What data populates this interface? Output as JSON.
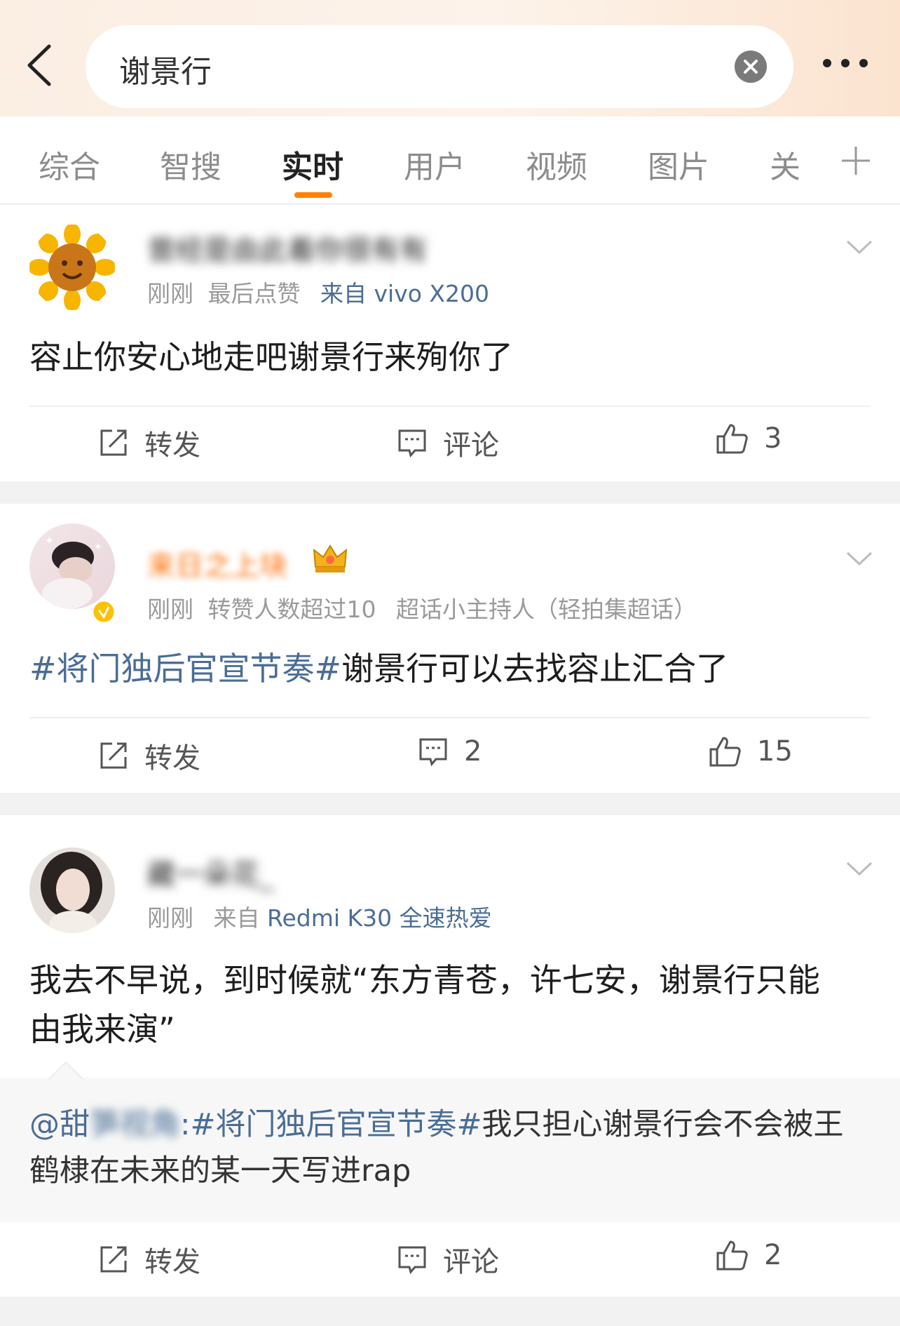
{
  "header": {
    "search_text": "谢景行"
  },
  "tabs": [
    {
      "label": "综合"
    },
    {
      "label": "智搜"
    },
    {
      "label": "实时",
      "active": true
    },
    {
      "label": "用户"
    },
    {
      "label": "视频"
    },
    {
      "label": "图片"
    },
    {
      "label": "关"
    }
  ],
  "colors": {
    "accent": "#ff8200",
    "link": "#4a6d96",
    "verified_badge": "#ffc107"
  },
  "posts": [
    {
      "username": "曾经是由此着你很有有",
      "meta_time": "刚刚",
      "meta_info": "最后点赞",
      "meta_source": "来自 vivo X200",
      "text": "容止你安心地走吧谢景行来殉你了",
      "repost_label": "转发",
      "comment_label": "评论",
      "like_count": "3"
    },
    {
      "username": "来日之上块",
      "meta_time": "刚刚",
      "meta_info": "转赞人数超过10",
      "meta_source": "超话小主持人（轻拍集超话）",
      "topic": "#将门独后官宣节奏#",
      "text": "谢景行可以去找容止汇合了",
      "repost_label": "转发",
      "comment_count": "2",
      "like_count": "15"
    },
    {
      "username": "藏一朵花_",
      "meta_time": "刚刚",
      "meta_source_prefix": "来自",
      "meta_source": "Redmi K30 全速热爱",
      "text_line1": "我去不早说，到时候就“东方青苍，许七安，谢景行只能",
      "text_line2": "由我来演”",
      "quote_mention": "@甜",
      "quote_mention_blurred": "笋视角",
      "quote_topic": ":#将门独后官宣节奏#",
      "quote_text_line1": "我只担心谢景行会不会被王",
      "quote_text_line2": "鹤棣在未来的某一天写进rap",
      "repost_label": "转发",
      "comment_label": "评论",
      "like_count": "2"
    }
  ]
}
